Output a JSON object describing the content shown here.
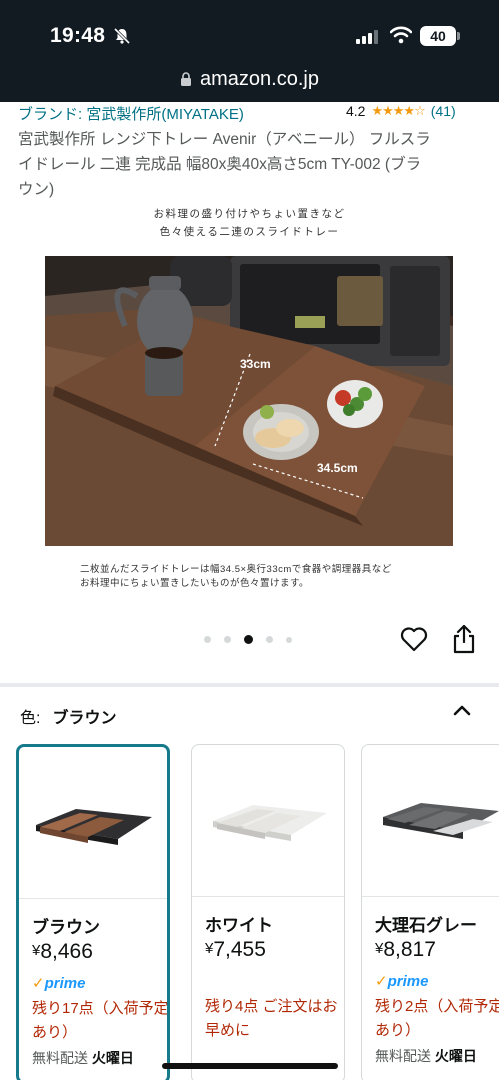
{
  "status_bar": {
    "time": "19:48",
    "battery": "40"
  },
  "browser": {
    "url": "amazon.co.jp"
  },
  "product": {
    "brand": "ブランド: 宮武製作所(MIYATAKE)",
    "rating_value": "4.2",
    "rating_stars": "★★★★☆",
    "rating_count": "(41)",
    "title_lines": [
      "宮武製作所 レンジ下トレー Avenir（アベニール） フルスラ",
      "イドレール 二連 完成品 幅80x奥40x高さ5cm TY-002 (ブラ",
      "ウン)"
    ]
  },
  "image": {
    "caption_top": [
      "お料理の盛り付けやちょい置きなど",
      "色々使える二連のスライドトレー"
    ],
    "dim_depth": "33cm",
    "dim_width": "34.5cm",
    "caption_bottom": [
      "二枚並んだスライドトレーは幅34.5×奥行33cmで食器や調理器具など",
      "お料理中にちょい置きしたいものが色々置けます。"
    ],
    "carousel_total": 5,
    "carousel_active_index": 2
  },
  "color_selector": {
    "label": "色:",
    "selected": "ブラウン",
    "options": [
      {
        "name": "ブラウン",
        "yen": "¥",
        "price": "8,466",
        "prime": "prime",
        "stock": "残り17点（入荷予定あり）",
        "ship_prefix": "無料配送",
        "ship_day": "火曜日"
      },
      {
        "name": "ホワイト",
        "yen": "¥",
        "price": "7,455",
        "prime": "",
        "stock": "残り4点 ご注文はお早めに",
        "ship_prefix": "",
        "ship_day": ""
      },
      {
        "name": "大理石グレー",
        "yen": "¥",
        "price": "8,817",
        "prime": "prime",
        "stock": "残り2点（入荷予定あり）",
        "ship_prefix": "無料配送",
        "ship_day": "火曜日"
      }
    ]
  },
  "colors": {
    "link": "#007185",
    "star": "#f29b11",
    "prime": "#1a98ff",
    "stock": "#b12704",
    "selected_border": "#177a8a"
  }
}
